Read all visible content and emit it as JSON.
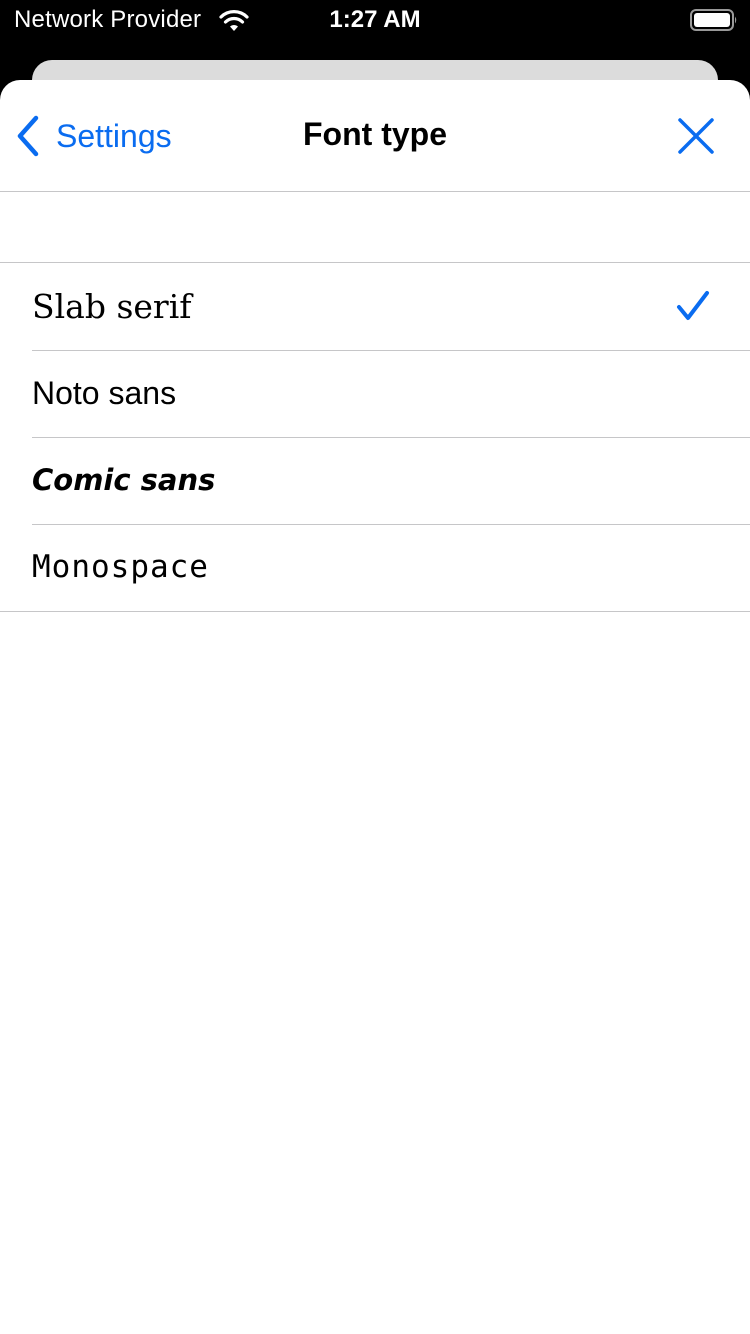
{
  "status_bar": {
    "carrier": "Network Provider",
    "time": "1:27 AM",
    "wifi_icon": "wifi-icon",
    "battery_icon": "battery-full-icon"
  },
  "nav": {
    "back_label": "Settings",
    "title": "Font type",
    "back_icon": "chevron-left-icon",
    "close_icon": "close-icon"
  },
  "accent_color": "#0a6cf0",
  "font_options": [
    {
      "label": "Slab serif",
      "selected": true
    },
    {
      "label": "Noto sans",
      "selected": false
    },
    {
      "label": "Comic sans",
      "selected": false
    },
    {
      "label": "Monospace",
      "selected": false
    }
  ]
}
